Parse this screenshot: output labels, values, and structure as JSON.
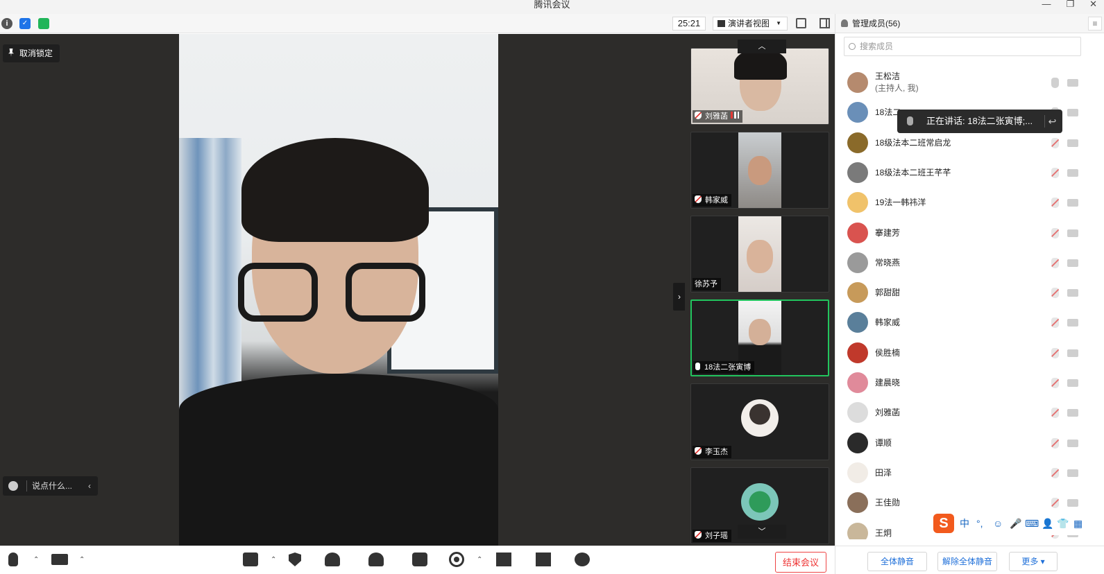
{
  "window": {
    "title": "腾讯会议",
    "controls": [
      "—",
      "❐",
      "✕"
    ]
  },
  "toolbar": {
    "timer": "25:21",
    "view_mode": "演讲者视图",
    "info_icon": "info-icon",
    "shield_icon": "shield-icon",
    "signal_icon": "signal-icon"
  },
  "stage": {
    "unlock_label": "取消锁定",
    "chat_placeholder": "说点什么...",
    "collapse_glyph": "‹",
    "expand_glyph": "›"
  },
  "thumbnails": [
    {
      "name": "刘雅菡",
      "mic": "off",
      "signal": true,
      "kind": "video",
      "bg": "#e8e2dc"
    },
    {
      "name": "韩家威",
      "mic": "off",
      "signal": false,
      "kind": "portrait",
      "bg": "#bfc5c9"
    },
    {
      "name": "徐苏予",
      "mic": "none",
      "signal": false,
      "kind": "portrait",
      "bg": "#e9e5e1"
    },
    {
      "name": "18法二张寅博",
      "mic": "on",
      "signal": false,
      "kind": "portrait",
      "bg": "#f2f2f2",
      "speaking": true
    },
    {
      "name": "李玉杰",
      "mic": "off",
      "signal": false,
      "kind": "avatar",
      "bg": "#f4f1ee"
    },
    {
      "name": "刘子瑶",
      "mic": "off",
      "signal": false,
      "kind": "avatar",
      "bg": "#7cc6b9"
    }
  ],
  "scroll": {
    "up": "︿",
    "down": "﹀"
  },
  "bottombar": {
    "end_meeting": "结束会议",
    "icons": [
      "mic-icon",
      "camera-icon",
      "share-screen-icon",
      "security-icon",
      "invite-icon",
      "members-icon",
      "chat-icon",
      "record-icon",
      "layout-icon",
      "apps-icon",
      "settings-icon"
    ],
    "caret": "⌃"
  },
  "panel": {
    "title": "管理成员(56)",
    "search_placeholder": "搜索成员",
    "menu_glyph": "≡",
    "members": [
      {
        "name": "王松洁",
        "sub": "(主持人, 我)",
        "mic": "on",
        "color": "#b58a6e"
      },
      {
        "name": "18法二",
        "sub": "",
        "mic": "on",
        "color": "#6a8fb8"
      },
      {
        "name": "18级法本二班常启龙",
        "sub": "",
        "mic": "off",
        "color": "#8a6a2a"
      },
      {
        "name": "18级法本二班王芊芊",
        "sub": "",
        "mic": "off",
        "color": "#7a7a7a"
      },
      {
        "name": "19法一韩祎洋",
        "sub": "",
        "mic": "off",
        "color": "#f0c26a"
      },
      {
        "name": "搴建芳",
        "sub": "",
        "mic": "off",
        "color": "#d9534f"
      },
      {
        "name": "常晓燕",
        "sub": "",
        "mic": "off",
        "color": "#9a9a9a"
      },
      {
        "name": "郭甜甜",
        "sub": "",
        "mic": "off",
        "color": "#c79a5a"
      },
      {
        "name": "韩家威",
        "sub": "",
        "mic": "off",
        "color": "#5a7f9a"
      },
      {
        "name": "侯胜楠",
        "sub": "",
        "mic": "off",
        "color": "#c0392b"
      },
      {
        "name": "建晨晓",
        "sub": "",
        "mic": "off",
        "color": "#e08a9a"
      },
      {
        "name": "刘雅菡",
        "sub": "",
        "mic": "off",
        "color": "#dcdcdc"
      },
      {
        "name": "谭顺",
        "sub": "",
        "mic": "off",
        "color": "#2a2a2a"
      },
      {
        "name": "田泽",
        "sub": "",
        "mic": "off",
        "color": "#f1ece6"
      },
      {
        "name": "王佳勋",
        "sub": "",
        "mic": "off",
        "color": "#8a6f5a"
      },
      {
        "name": "王炯",
        "sub": "",
        "mic": "off",
        "color": "#c9b79a"
      }
    ],
    "speaking_tip": "正在讲话: 18法二张寅博;...",
    "tip_back_glyph": "↩",
    "footer": {
      "mute_all": "全体静音",
      "unmute_all": "解除全体静音",
      "more": "更多 ▾"
    }
  },
  "ime": {
    "logo": "S",
    "items": [
      "中",
      "°,",
      "☺",
      "🎤",
      "⌨",
      "👤",
      "👕",
      "▦"
    ]
  }
}
